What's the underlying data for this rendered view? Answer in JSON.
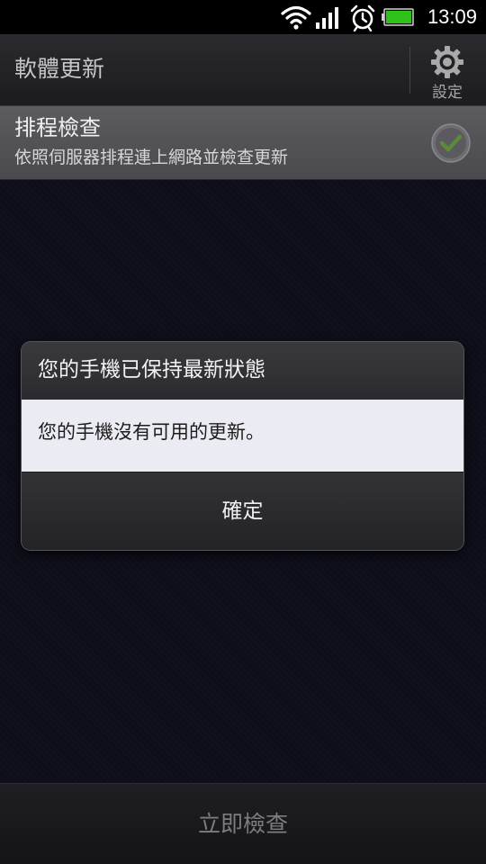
{
  "status_bar": {
    "time": "13:09",
    "icons": [
      "wifi-icon",
      "signal-icon",
      "alarm-icon",
      "battery-icon"
    ]
  },
  "header": {
    "title": "軟體更新",
    "settings_label": "設定",
    "settings_icon": "gear-icon"
  },
  "schedule_check": {
    "title": "排程檢查",
    "subtitle": "依照伺服器排程連上網路並檢查更新",
    "checked": true
  },
  "dialog": {
    "title": "您的手機已保持最新狀態",
    "message": "您的手機沒有可用的更新。",
    "ok_label": "確定"
  },
  "footer": {
    "check_now_label": "立即檢查"
  },
  "colors": {
    "background": "#0e0e18",
    "dialog_body": "#ebebf3",
    "check_mark": "#5a8a3a",
    "battery": "#2ec21b"
  }
}
